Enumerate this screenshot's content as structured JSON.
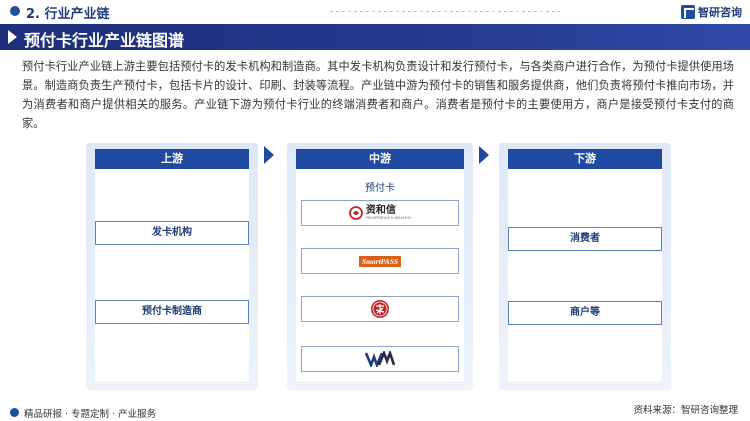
{
  "section": {
    "title": "2. 行业产业链"
  },
  "brand": {
    "name": "智研咨询"
  },
  "banner": {
    "title": "预付卡行业产业链图谱"
  },
  "intro": "预付卡行业产业链上游主要包括预付卡的发卡机构和制造商。其中发卡机构负责设计和发行预付卡，与各类商户进行合作，为预付卡提供使用场景。制造商负责生产预付卡，包括卡片的设计、印刷、封装等流程。产业链中游为预付卡的销售和服务提供商，他们负责将预付卡推向市场，并为消费者和商户提供相关的服务。产业链下游为预付卡行业的终端消费者和商户。消费者是预付卡的主要使用方，商户是接受预付卡支付的商家。",
  "upstream": {
    "title": "上游",
    "items": [
      "发卡机构",
      "预付卡制造商"
    ]
  },
  "midstream": {
    "title": "中游",
    "subtitle": "预付卡",
    "logos": [
      {
        "name": "资和信",
        "sub": "PROSPEROUS & WEALTHY"
      },
      {
        "name": "SmartPASS"
      },
      {
        "name": ""
      },
      {
        "name": ""
      }
    ]
  },
  "downstream": {
    "title": "下游",
    "items": [
      "消费者",
      "商户等"
    ]
  },
  "footer": {
    "left": "精品研报 · 专题定制 · 产业服务",
    "right": "资料来源：智研咨询整理"
  },
  "colors": {
    "primary": "#1f4aa0",
    "banner": "#1e2f7a",
    "panel": "#dfe8f7",
    "logo_red": "#c0282d"
  }
}
